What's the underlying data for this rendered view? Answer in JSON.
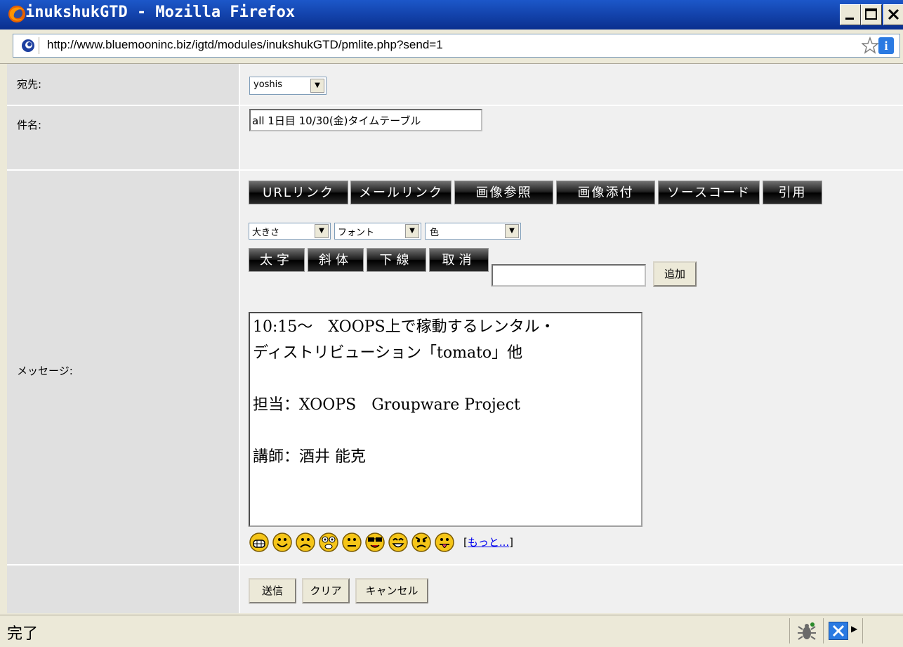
{
  "window": {
    "title": "inukshukGTD - Mozilla Firefox"
  },
  "urlbar": {
    "url": "http://www.bluemooninc.biz/igtd/modules/inukshukGTD/pmlite.php?send=1"
  },
  "form": {
    "to_label": "宛先:",
    "to_value": "yoshis",
    "subject_label": "件名:",
    "subject_value": "all 1日目 10/30(金)タイムテーブル",
    "message_label": "メッセージ:",
    "toolbar_buttons": [
      "URLリンク",
      "メールリンク",
      "画像参照",
      "画像添付",
      "ソースコード",
      "引用"
    ],
    "size_select": "大きさ",
    "font_select": "フォント",
    "color_select": "色",
    "format_buttons": [
      "太字",
      "斜体",
      "下線",
      "取消"
    ],
    "add_button": "追加",
    "add_input": "",
    "message_body": "10:15～　XOOPS上で稼動するレンタル・\nディストリビューション「tomato」他\n\n担当：XOOPS　Groupware Project\n\n講師：酒井 能克",
    "more_prefix": "[",
    "more_link": "もっと...",
    "more_suffix": "]",
    "smileys": [
      "biggrin-icon",
      "smile-icon",
      "sad-icon",
      "eek-icon",
      "neutral-icon",
      "cool-icon",
      "lol-icon",
      "mad-icon",
      "razz-icon"
    ]
  },
  "actions": {
    "send": "送信",
    "clear": "クリア",
    "cancel": "キャンセル"
  },
  "statusbar": {
    "status": "完了"
  }
}
